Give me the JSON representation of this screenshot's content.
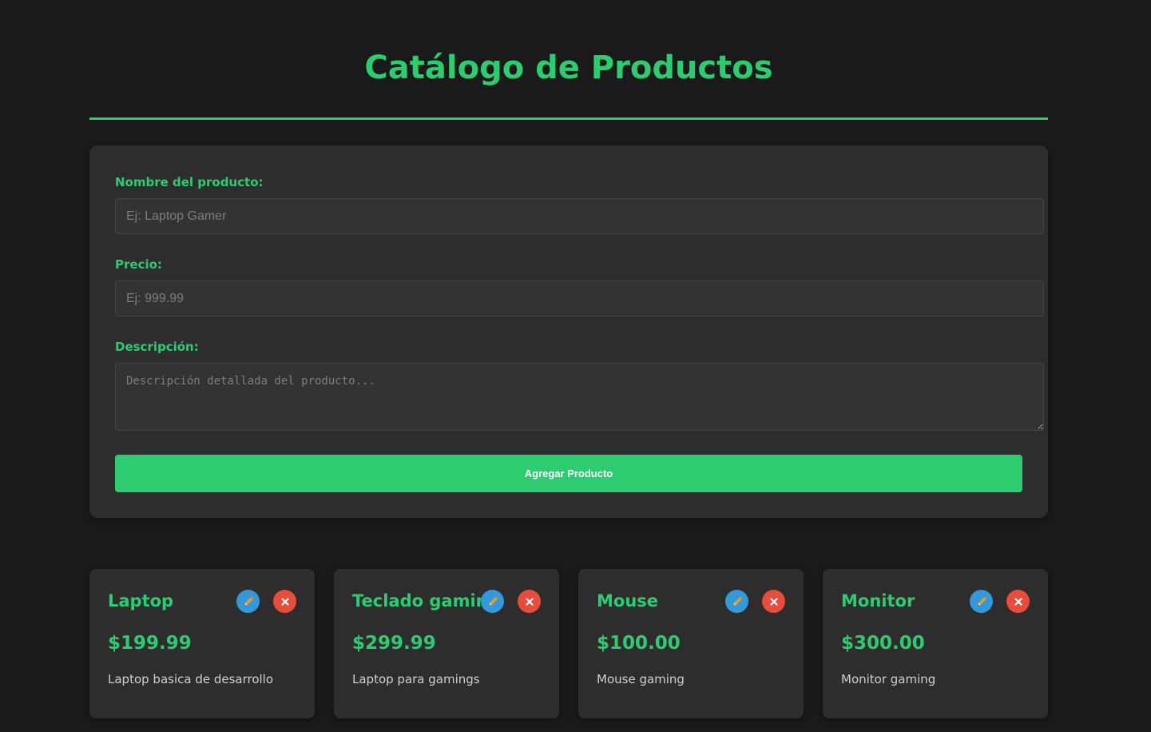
{
  "header": {
    "title": "Catálogo de Productos"
  },
  "form": {
    "name_label": "Nombre del producto:",
    "name_placeholder": "Ej: Laptop Gamer",
    "price_label": "Precio:",
    "price_placeholder": "Ej: 999.99",
    "description_label": "Descripción:",
    "description_placeholder": "Descripción detallada del producto...",
    "submit_label": "Agregar Producto"
  },
  "products": [
    {
      "name": "Laptop",
      "price": "$199.99",
      "description": "Laptop basica de desarrollo"
    },
    {
      "name": "Teclado gaming",
      "price": "$299.99",
      "description": "Laptop para gamings"
    },
    {
      "name": "Mouse",
      "price": "$100.00",
      "description": "Mouse gaming"
    },
    {
      "name": "Monitor",
      "price": "$300.00",
      "description": "Monitor gaming"
    }
  ],
  "icons": {
    "edit": "pencil-icon",
    "delete": "close-icon"
  },
  "colors": {
    "accent": "#2ecc71",
    "background": "#1a1a1a",
    "panel": "#2d2d2d",
    "edit": "#3498db",
    "delete": "#e74c3c"
  }
}
